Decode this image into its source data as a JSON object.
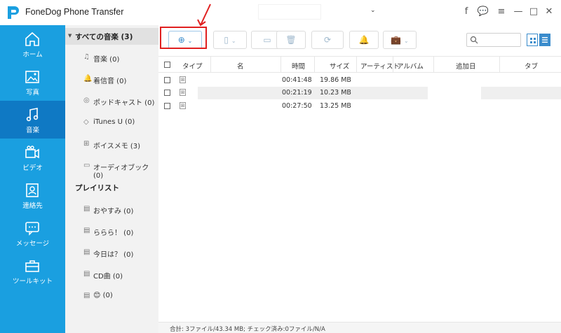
{
  "window": {
    "title": "FoneDog Phone Transfer",
    "device_caret": "⌄",
    "controls": {
      "facebook": "f",
      "feedback": "💬",
      "menu": "≡",
      "minimize": "—",
      "maximize": "□",
      "close": "✕"
    }
  },
  "nav": {
    "items": [
      {
        "label": "ホーム",
        "icon": "home-icon"
      },
      {
        "label": "写真",
        "icon": "photo-icon"
      },
      {
        "label": "音楽",
        "icon": "music-icon",
        "active": true
      },
      {
        "label": "ビデオ",
        "icon": "video-icon"
      },
      {
        "label": "連絡先",
        "icon": "contacts-icon"
      },
      {
        "label": "メッセージ",
        "icon": "message-icon"
      },
      {
        "label": "ツールキット",
        "icon": "toolbox-icon"
      }
    ]
  },
  "categories": {
    "all_label": "すべての音楽 (3)",
    "items": [
      {
        "label": "音楽 (0)",
        "icon": "♫"
      },
      {
        "label": "着信音 (0)",
        "icon": "🔔"
      },
      {
        "label": "ポッドキャスト (0)",
        "icon": "◎"
      },
      {
        "label": "iTunes U (0)",
        "icon": "◇"
      },
      {
        "label": "ボイスメモ (3)",
        "icon": "⊞"
      },
      {
        "label": "オーディオブック (0)",
        "icon": "▭"
      }
    ],
    "playlist_heading": "プレイリスト",
    "playlists": [
      {
        "label": "おやすみ (0)",
        "icon": "▤"
      },
      {
        "label": "ららら！ (0)",
        "icon": "▤"
      },
      {
        "label": "今日は？ (0)",
        "icon": "▤"
      },
      {
        "label": "CD曲 (0)",
        "icon": "▤"
      },
      {
        "label": "😊 (0)",
        "icon": "▤"
      }
    ]
  },
  "toolbar": {
    "add_icon": "⊕",
    "add_caret": "⌄",
    "export_device_icon": "▯",
    "export_device_caret": "⌄",
    "export_pc_icon": "▭",
    "delete_icon": "🗑",
    "sync_icon": "⟳",
    "ringtone_icon": "🔔",
    "toolbox_icon": "💼",
    "toolbox_caret": "⌄",
    "search_icon": "○"
  },
  "table": {
    "columns": [
      "タイプ",
      "名",
      "時間",
      "サイズ",
      "アーティスト",
      "アルバム",
      "追加日",
      "タブ"
    ],
    "rows": [
      {
        "type": "⊞",
        "name": "",
        "time": "00:41:48",
        "size": "19.86 MB",
        "artist": "",
        "album": "",
        "added": "",
        "tab": ""
      },
      {
        "type": "⊞",
        "name": "",
        "time": "00:21:19",
        "size": "10.23 MB",
        "artist": "",
        "album": "",
        "added": "",
        "tab": ""
      },
      {
        "type": "⊞",
        "name": "",
        "time": "00:27:50",
        "size": "13.25 MB",
        "artist": "",
        "album": "",
        "added": "",
        "tab": ""
      }
    ]
  },
  "status": {
    "text": "合計: 3ファイル/43.34 MB; チェック済み:0ファイル/N/A"
  },
  "colors": {
    "nav_bg": "#1a9fe0",
    "nav_active": "#0f79c4",
    "accent": "#3a8ccc",
    "highlight": "#e02020"
  }
}
